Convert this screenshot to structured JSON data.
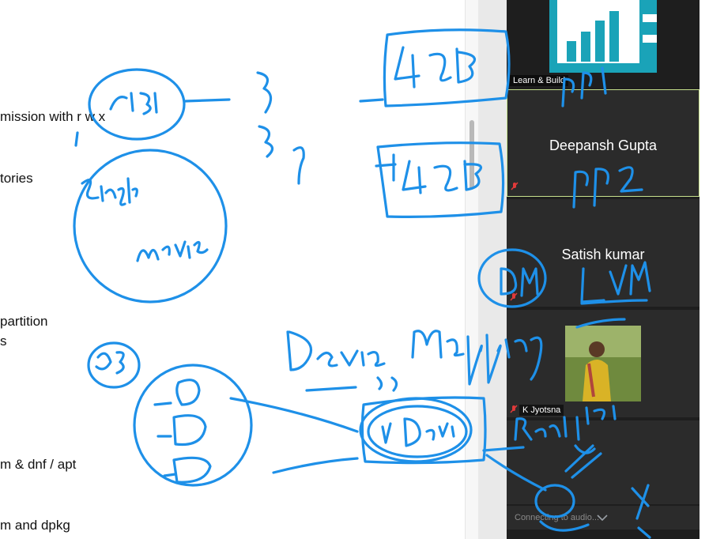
{
  "document": {
    "lines": [
      "mission with r   w   x",
      "tories",
      "partition",
      "s",
      "m & dnf / apt",
      "m and dpkg"
    ]
  },
  "participants": {
    "tile1_label": "Learn & Build",
    "tile2_name": "Deepansh Gupta",
    "tile3_name": "Satish kumar",
    "tile4_label": "K Jyotsna"
  },
  "bottom_bar": {
    "text": "Connecting to audio..."
  },
  "annotations": {
    "handwritten_text": [
      "6GB",
      "4GB",
      "4GB",
      "Single",
      "movie",
      "PP1",
      "PP2",
      "DM",
      "LVM",
      "Device mapping",
      "OS",
      "V Device",
      "Real HDD",
      "X"
    ]
  },
  "colors": {
    "ink": "#1e90e8",
    "panel_bg": "#1e1e1e",
    "tile_bg": "#2b2b2b",
    "active_border": "#c6e08c",
    "logo_teal": "#1aa3b8"
  }
}
